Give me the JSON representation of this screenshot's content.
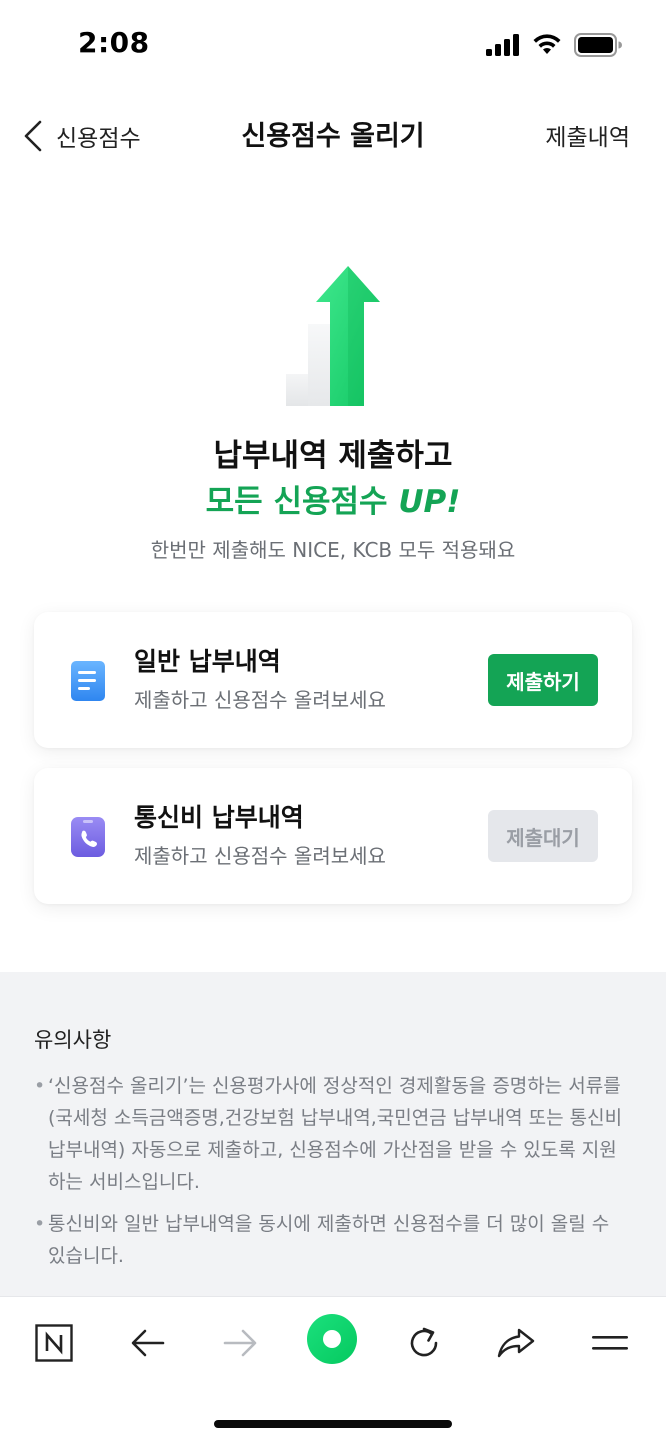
{
  "status_bar": {
    "time": "2:08"
  },
  "nav": {
    "back_label": "신용점수",
    "title": "신용점수 올리기",
    "history_label": "제출내역"
  },
  "hero": {
    "headline": "납부내역 제출하고",
    "accent_prefix": "모든 신용점수 ",
    "accent_up": "UP!",
    "subtext": "한번만 제출해도 NICE, KCB 모두 적용돼요"
  },
  "cards": [
    {
      "title": "일반 납부내역",
      "desc": "제출하고 신용점수 올려보세요",
      "button": "제출하기",
      "icon": "document-icon"
    },
    {
      "title": "통신비 납부내역",
      "desc": "제출하고 신용점수 올려보세요",
      "button": "제출대기",
      "icon": "phone-icon"
    }
  ],
  "notice": {
    "title": "유의사항",
    "items": [
      "‘신용점수 올리기’는 신용평가사에 정상적인 경제활동을 증명하는 서류를(국세청 소득금액증명,건강보험 납부내역,국민연금 납부내역 또는 통신비 납부내역) 자동으로 제출하고, 신용점수에 가산점을 받을 수 있도록 지원하는 서비스입니다.",
      "통신비와 일반 납부내역을 동시에 제출하면 신용점수를 더 많이 올릴 수 있습니다."
    ]
  },
  "colors": {
    "accent_green": "#14a455",
    "arrow_green": "#22d97a",
    "disabled_gray": "#e5e7eb",
    "notice_bg": "#f2f3f5"
  },
  "toolbar_icons": [
    "naver-n-icon",
    "back-arrow-icon",
    "forward-arrow-icon",
    "green-circle-icon",
    "reload-icon",
    "share-icon",
    "menu-icon"
  ]
}
